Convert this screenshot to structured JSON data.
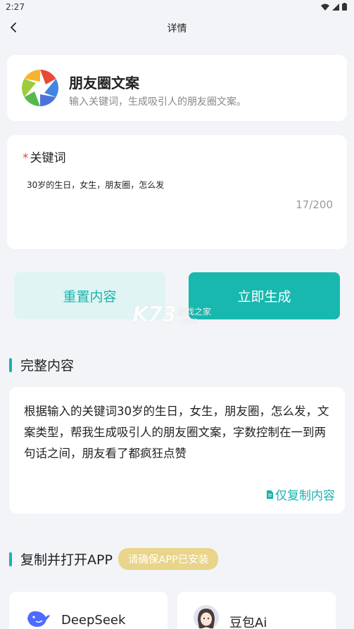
{
  "status": {
    "time": "2:27"
  },
  "nav": {
    "title": "详情"
  },
  "app_card": {
    "name": "朋友圈文案",
    "description": "输入关键词，生成吸引人的朋友圈文案。"
  },
  "keyword": {
    "required_mark": "*",
    "label": "关键词",
    "value": "30岁的生日，女生，朋友圈，怎么发",
    "count": "17/200"
  },
  "buttons": {
    "reset": "重置内容",
    "generate": "立即生成"
  },
  "watermark": {
    "logo": "K73",
    "line1": "游戏之家",
    "line2": ".com"
  },
  "full_content": {
    "title": "完整内容",
    "text": "根据输入的关键词30岁的生日，女生，朋友圈，怎么发，文案类型，帮我生成吸引人的朋友圈文案，字数控制在一到两句话之间，朋友看了都疯狂点赞",
    "copy_label": "仅复制内容"
  },
  "open_app": {
    "title": "复制并打开APP",
    "badge": "请确保APP已安装",
    "apps": [
      {
        "name": "DeepSeek"
      },
      {
        "name": "豆包Ai"
      }
    ]
  },
  "colors": {
    "accent": "#19b3ad",
    "required": "#e5483b",
    "badge": "#e8d58a"
  }
}
